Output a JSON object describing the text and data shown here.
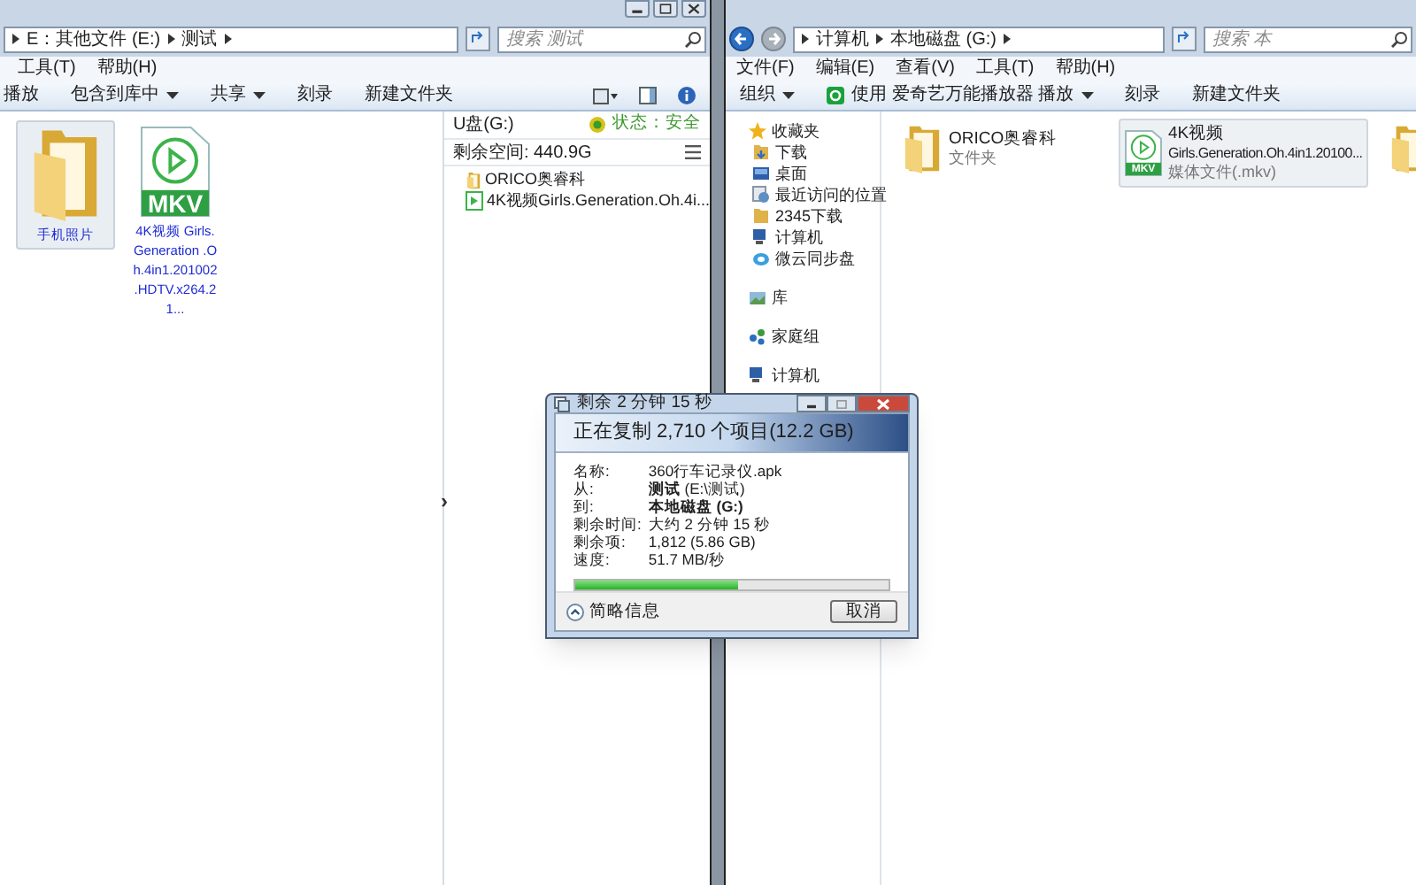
{
  "left_window": {
    "address": [
      "E：其他文件 (E:)",
      "测试"
    ],
    "search": {
      "placeholder": "搜索 测试"
    },
    "menu": [
      "工具(T)",
      "帮助(H)"
    ],
    "toolbar": [
      {
        "label": "播放",
        "dropdown": false
      },
      {
        "label": "包含到库中",
        "dropdown": true
      },
      {
        "label": "共享",
        "dropdown": true
      },
      {
        "label": "刻录",
        "dropdown": false
      },
      {
        "label": "新建文件夹",
        "dropdown": false
      }
    ],
    "files": [
      {
        "kind": "folder",
        "name": "手机照片",
        "selected": true
      },
      {
        "kind": "video",
        "badge": "MKV",
        "name": "4K视频 Girls.Generation .Oh.4in1.201002 .HDTV.x264.21...",
        "selected": false
      }
    ],
    "details": {
      "drive": "U盘(G:)",
      "status": "状态：安全",
      "free_space": "剩余空间: 440.9G",
      "items": [
        {
          "kind": "folder",
          "name": "ORICO奥睿科"
        },
        {
          "kind": "video",
          "name": "4K视频Girls.Generation.Oh.4i..."
        }
      ]
    },
    "expand_arrow": "›"
  },
  "right_window": {
    "address": [
      "计算机",
      "本地磁盘 (G:)"
    ],
    "search": {
      "placeholder": "搜索 本"
    },
    "menu": [
      "文件(F)",
      "编辑(E)",
      "查看(V)",
      "工具(T)",
      "帮助(H)"
    ],
    "toolbar": [
      {
        "label": "组织",
        "dropdown": true,
        "kind": "plain"
      },
      {
        "label": "使用 爱奇艺万能播放器 播放",
        "dropdown": true,
        "kind": "app"
      },
      {
        "label": "刻录",
        "dropdown": false,
        "kind": "plain"
      },
      {
        "label": "新建文件夹",
        "dropdown": false,
        "kind": "plain"
      }
    ],
    "nav": [
      {
        "label": "收藏夹",
        "children": [
          {
            "label": "下载"
          },
          {
            "label": "桌面"
          },
          {
            "label": "最近访问的位置"
          },
          {
            "label": "2345下载"
          },
          {
            "label": "计算机"
          },
          {
            "label": "微云同步盘"
          }
        ]
      },
      {
        "label": "库"
      },
      {
        "label": "家庭组"
      },
      {
        "label": "计算机"
      }
    ],
    "files": [
      {
        "kind": "folder",
        "name": "ORICO奥睿科",
        "type": "文件夹",
        "selected": false
      },
      {
        "kind": "video",
        "badge": "MKV",
        "name": "4K视频",
        "name2": "Girls.Generation.Oh.4in1.20100...",
        "type": "媒体文件(.mkv)",
        "selected": true
      },
      {
        "kind": "folder",
        "selected": false
      }
    ]
  },
  "dialog": {
    "title": "剩余 2 分钟 15 秒",
    "heading": "正在复制 2,710 个项目(12.2 GB)",
    "rows": [
      {
        "label": "名称:",
        "value": "360行车记录仪.apk",
        "bold": false
      },
      {
        "label": "从:",
        "value": "**测试** (E:\\测试)",
        "bold": false
      },
      {
        "label": "到:",
        "value": "本地磁盘 (G:)",
        "bold": true
      },
      {
        "label": "剩余时间:",
        "value": "大约 2 分钟 15 秒",
        "bold": false
      },
      {
        "label": "剩余项:",
        "value": "1,812 (5.86 GB)",
        "bold": false
      },
      {
        "label": "速度:",
        "value": "51.7 MB/秒",
        "bold": false
      }
    ],
    "progress": {
      "level": 0.52
    },
    "toggle": "简略信息",
    "cancel": "取消"
  }
}
